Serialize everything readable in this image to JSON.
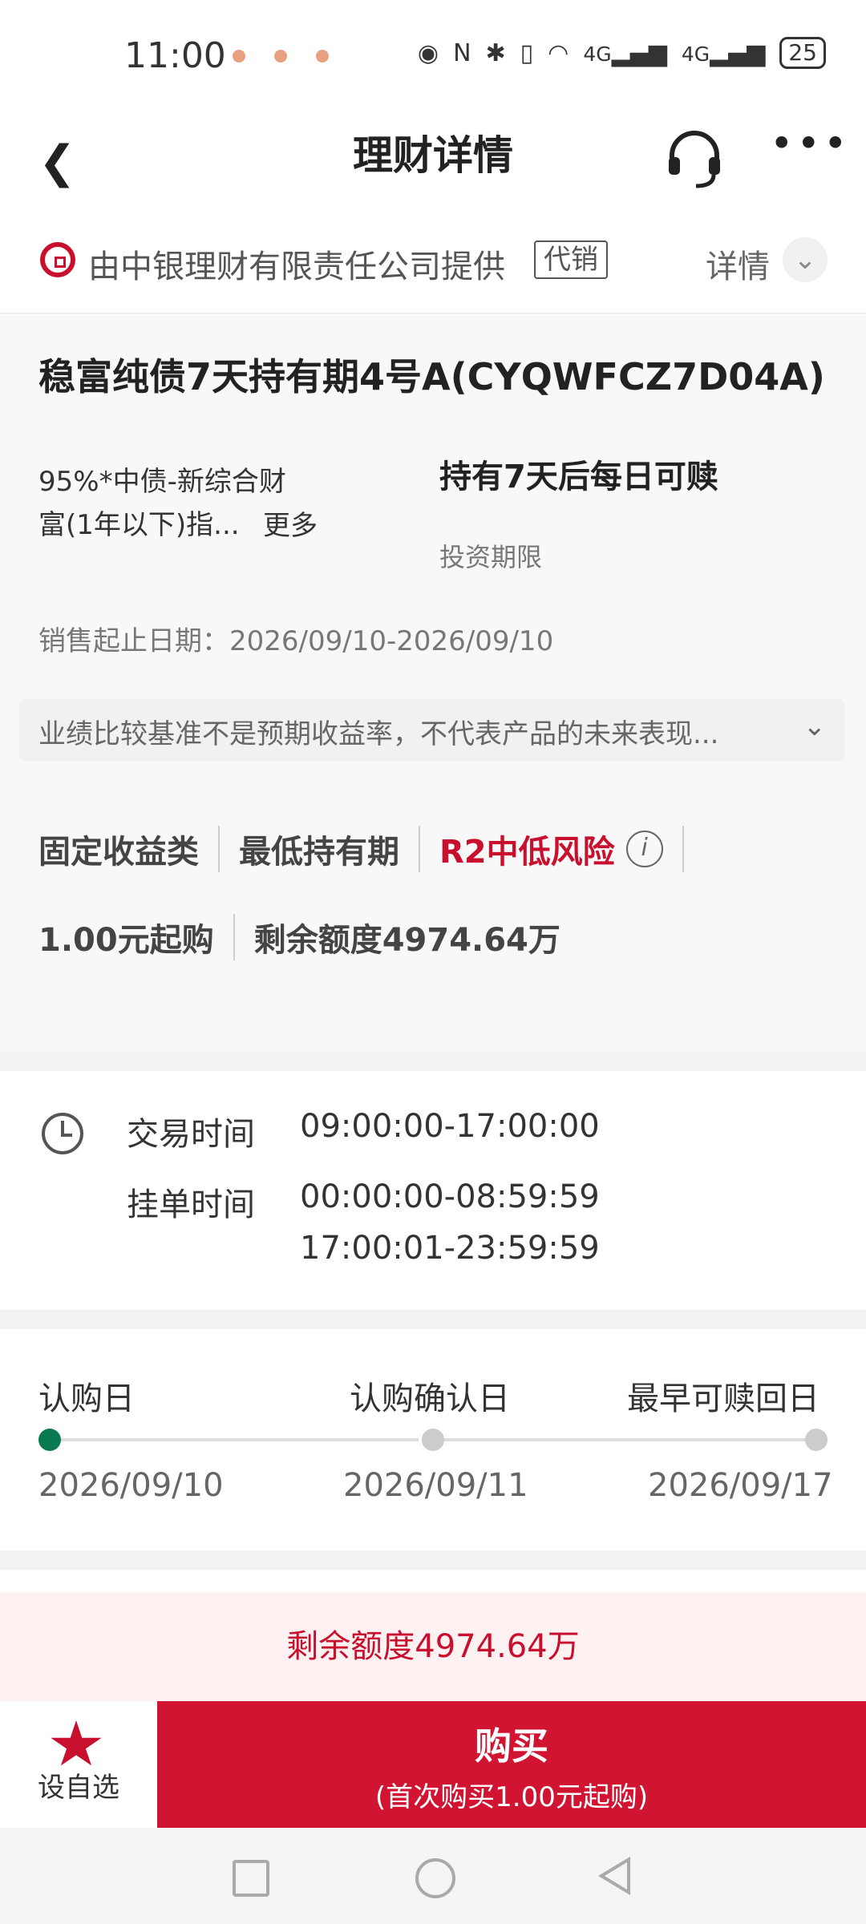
{
  "status_bar": {
    "time": "11:00",
    "network_1": "4G",
    "network_2": "4G",
    "battery": "25"
  },
  "header": {
    "title": "理财详情"
  },
  "provider": {
    "text": "由中银理财有限责任公司提供",
    "tag": "代销",
    "detail": "详情"
  },
  "product": {
    "name": "稳富纯债7天持有期4号A(CYQWFCZ7D04A)",
    "benchmark_line1": "95%*中债-新综合财",
    "benchmark_line2": "富(1年以下)指...",
    "benchmark_more": "更多",
    "redeem_rule": "持有7天后每日可赎",
    "redeem_label": "投资期限",
    "sale_period": "销售起止日期：2026/09/10-2026/09/10",
    "notice": "业绩比较基准不是预期收益率，不代表产品的未来表现...",
    "tags": [
      "固定收益类",
      "最低持有期",
      "R2中低风险"
    ],
    "min_purchase": "1.00元起购",
    "remaining": "剩余额度4974.64万"
  },
  "trading": {
    "trade_label": "交易时间",
    "trade_value": "09:00:00-17:00:00",
    "order_label": "挂单时间",
    "order_value_1": "00:00:00-08:59:59",
    "order_value_2": "17:00:01-23:59:59"
  },
  "timeline": {
    "steps": [
      {
        "label": "认购日",
        "date": "2026/09/10"
      },
      {
        "label": "认购确认日",
        "date": "2026/09/11"
      },
      {
        "label": "最早可赎回日",
        "date": "2026/09/17"
      }
    ],
    "active_color": "#0a7a50"
  },
  "quota_banner": "剩余额度4974.64万",
  "actions": {
    "watchlist_label": "设自选",
    "buy_label": "购买",
    "buy_sub": "(首次购买1.00元起购)"
  },
  "colors": {
    "brand_red": "#c8102e",
    "buy_red": "#d11432"
  }
}
